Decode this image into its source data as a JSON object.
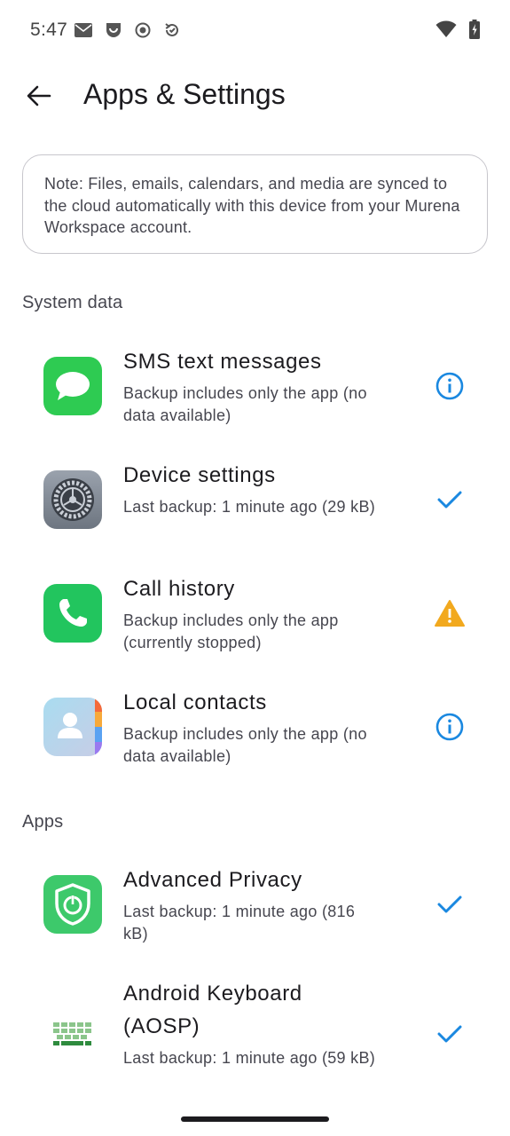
{
  "status_bar": {
    "time": "5:47",
    "left_icons": [
      "mail-icon",
      "beacon-icon",
      "record-icon",
      "sync-icon"
    ],
    "right_icons": [
      "wifi-icon",
      "battery-charging-icon"
    ]
  },
  "app_bar": {
    "back_icon": "arrow-back-icon",
    "title": "Apps & Settings"
  },
  "note": "Note: Files, emails, calendars, and media are synced to the cloud automatically with this device from your Murena Workspace account.",
  "sections": {
    "system": "System data",
    "apps": "Apps"
  },
  "system_items": [
    {
      "title": "SMS text messages",
      "subtitle": "Backup includes only the app (no data available)",
      "app_icon": "messages-app-icon",
      "status": "info-icon"
    },
    {
      "title": "Device settings",
      "subtitle": "Last backup: 1 minute ago (29 kB)",
      "app_icon": "settings-app-icon",
      "status": "check-icon"
    },
    {
      "title": "Call history",
      "subtitle": "Backup includes only the app (currently stopped)",
      "app_icon": "phone-app-icon",
      "status": "warning-icon"
    },
    {
      "title": "Local contacts",
      "subtitle": "Backup includes only the app (no data available)",
      "app_icon": "contacts-app-icon",
      "status": "info-icon"
    }
  ],
  "app_items": [
    {
      "title": "Advanced Privacy",
      "subtitle": "Last backup: 1 minute ago (816 kB)",
      "app_icon": "advanced-privacy-app-icon",
      "status": "check-icon"
    },
    {
      "title": "Android Keyboard (AOSP)",
      "subtitle": "Last backup: 1 minute ago (59 kB)",
      "app_icon": "keyboard-app-icon",
      "status": "check-icon"
    }
  ],
  "colors": {
    "accent_blue": "#1a88e0",
    "warning": "#f2a91e",
    "messages_green": "#2ecb52",
    "privacy_green": "#3dc96b"
  }
}
